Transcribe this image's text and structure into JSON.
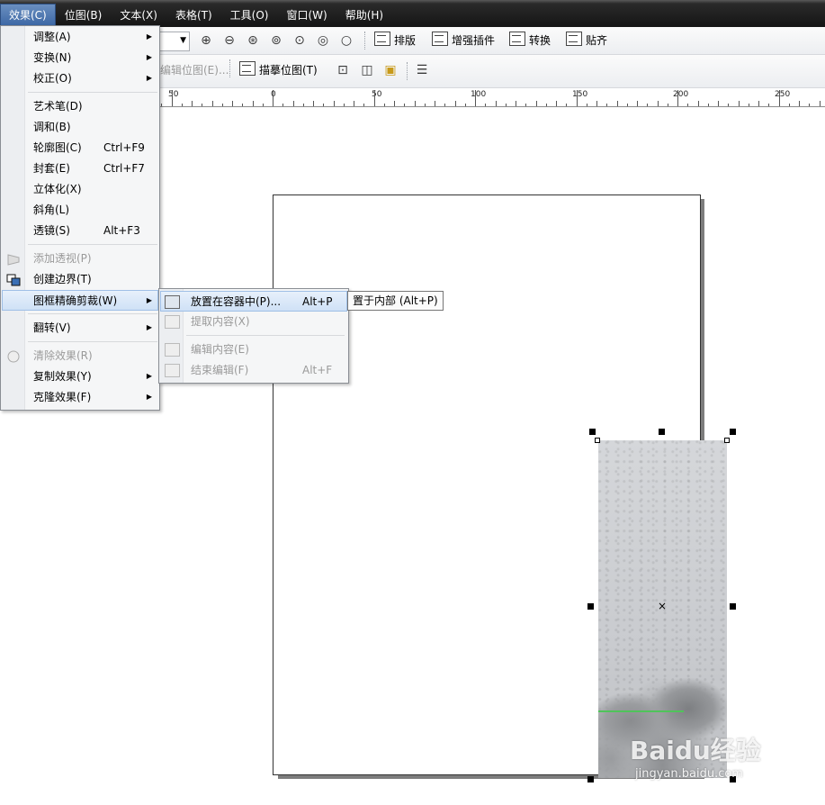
{
  "menubar": {
    "items": [
      "效果(C)",
      "位图(B)",
      "文本(X)",
      "表格(T)",
      "工具(O)",
      "窗口(W)",
      "帮助(H)"
    ]
  },
  "toolbar": {
    "layout_label": "排版",
    "plugin_label": "增强插件",
    "convert_label": "转换",
    "snap_label": "贴齐",
    "edit_bitmap_label": "编辑位图(E)...",
    "trace_bitmap_label": "描摹位图(T)"
  },
  "ruler": {
    "labels": [
      "50",
      "0",
      "50",
      "100",
      "150",
      "200",
      "250"
    ]
  },
  "effects_menu": {
    "items": [
      {
        "label": "调整(A)",
        "submenu": true
      },
      {
        "label": "变换(N)",
        "submenu": true
      },
      {
        "label": "校正(O)",
        "submenu": true
      },
      {
        "label": "艺术笔(D)"
      },
      {
        "label": "调和(B)"
      },
      {
        "label": "轮廓图(C)",
        "shortcut": "Ctrl+F9"
      },
      {
        "label": "封套(E)",
        "shortcut": "Ctrl+F7"
      },
      {
        "label": "立体化(X)"
      },
      {
        "label": "斜角(L)"
      },
      {
        "label": "透镜(S)",
        "shortcut": "Alt+F3"
      },
      {
        "label": "添加透视(P)",
        "disabled": true
      },
      {
        "label": "创建边界(T)"
      },
      {
        "label": "图框精确剪裁(W)",
        "submenu": true,
        "highlighted": true
      },
      {
        "label": "翻转(V)",
        "submenu": true
      },
      {
        "label": "清除效果(R)",
        "disabled": true
      },
      {
        "label": "复制效果(Y)",
        "submenu": true
      },
      {
        "label": "克隆效果(F)",
        "submenu": true
      }
    ]
  },
  "powerclip_submenu": {
    "items": [
      {
        "label": "放置在容器中(P)...",
        "shortcut": "Alt+P",
        "highlighted": true
      },
      {
        "label": "提取内容(X)",
        "disabled": true
      },
      {
        "label": "编辑内容(E)",
        "disabled": true
      },
      {
        "label": "结束编辑(F)",
        "shortcut": "Alt+F",
        "disabled": true
      }
    ]
  },
  "tooltip": {
    "text": "置于内部 (Alt+P)"
  },
  "watermark": {
    "text": "Baidu经验",
    "sub": "jingyan.baidu.com"
  },
  "colors": {
    "menubar_bg": "#1a1a1a",
    "menu_highlight": "#cfe1f6",
    "menubar_active": "#3b66a4"
  }
}
